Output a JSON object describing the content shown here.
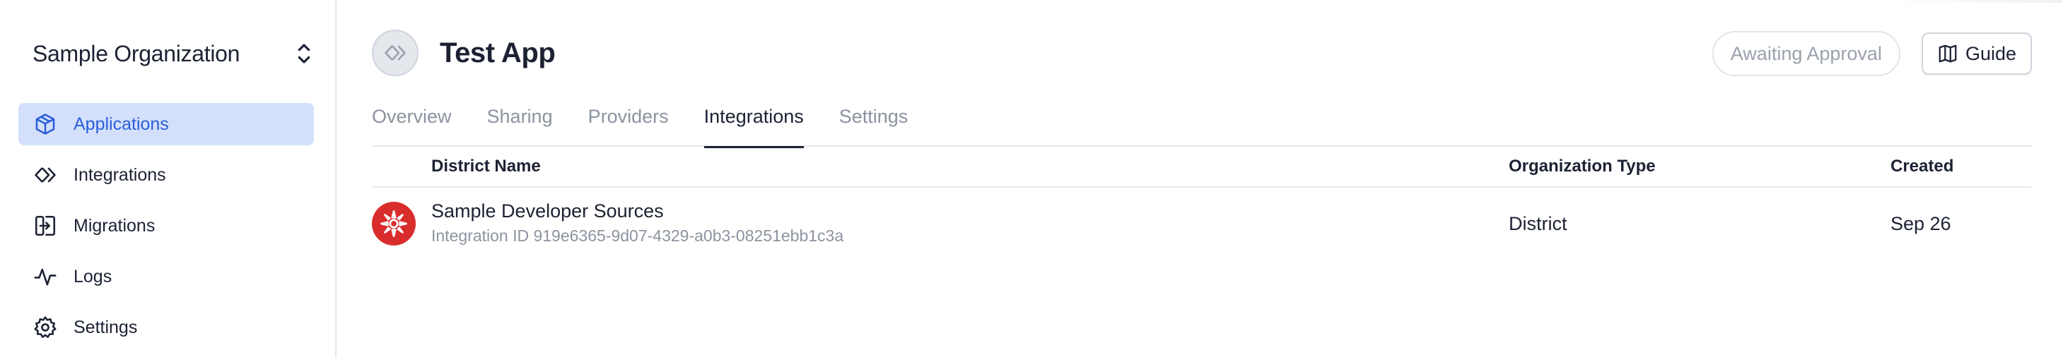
{
  "sidebar": {
    "org_name": "Sample Organization",
    "items": [
      {
        "label": "Applications",
        "icon": "cube-icon",
        "active": true
      },
      {
        "label": "Integrations",
        "icon": "integrations-icon",
        "active": false
      },
      {
        "label": "Migrations",
        "icon": "migrations-icon",
        "active": false
      },
      {
        "label": "Logs",
        "icon": "activity-icon",
        "active": false
      },
      {
        "label": "Settings",
        "icon": "gear-icon",
        "active": false
      }
    ]
  },
  "header": {
    "app_title": "Test App",
    "status": "Awaiting Approval",
    "guide_label": "Guide"
  },
  "tabs": [
    {
      "label": "Overview",
      "active": false
    },
    {
      "label": "Sharing",
      "active": false
    },
    {
      "label": "Providers",
      "active": false
    },
    {
      "label": "Integrations",
      "active": true
    },
    {
      "label": "Settings",
      "active": false
    }
  ],
  "table": {
    "columns": [
      "District Name",
      "Organization Type",
      "Created"
    ],
    "rows": [
      {
        "district_name": "Sample Developer Sources",
        "integration_id": "Integration ID 919e6365-9d07-4329-a0b3-08251ebb1c3a",
        "organization_type": "District",
        "created": "Sep 26"
      }
    ]
  },
  "colors": {
    "accent": "#2a5fd8",
    "active_nav_bg": "#d4e0fb",
    "logo_red": "#d92d2d",
    "muted_text": "#8c93a0"
  }
}
